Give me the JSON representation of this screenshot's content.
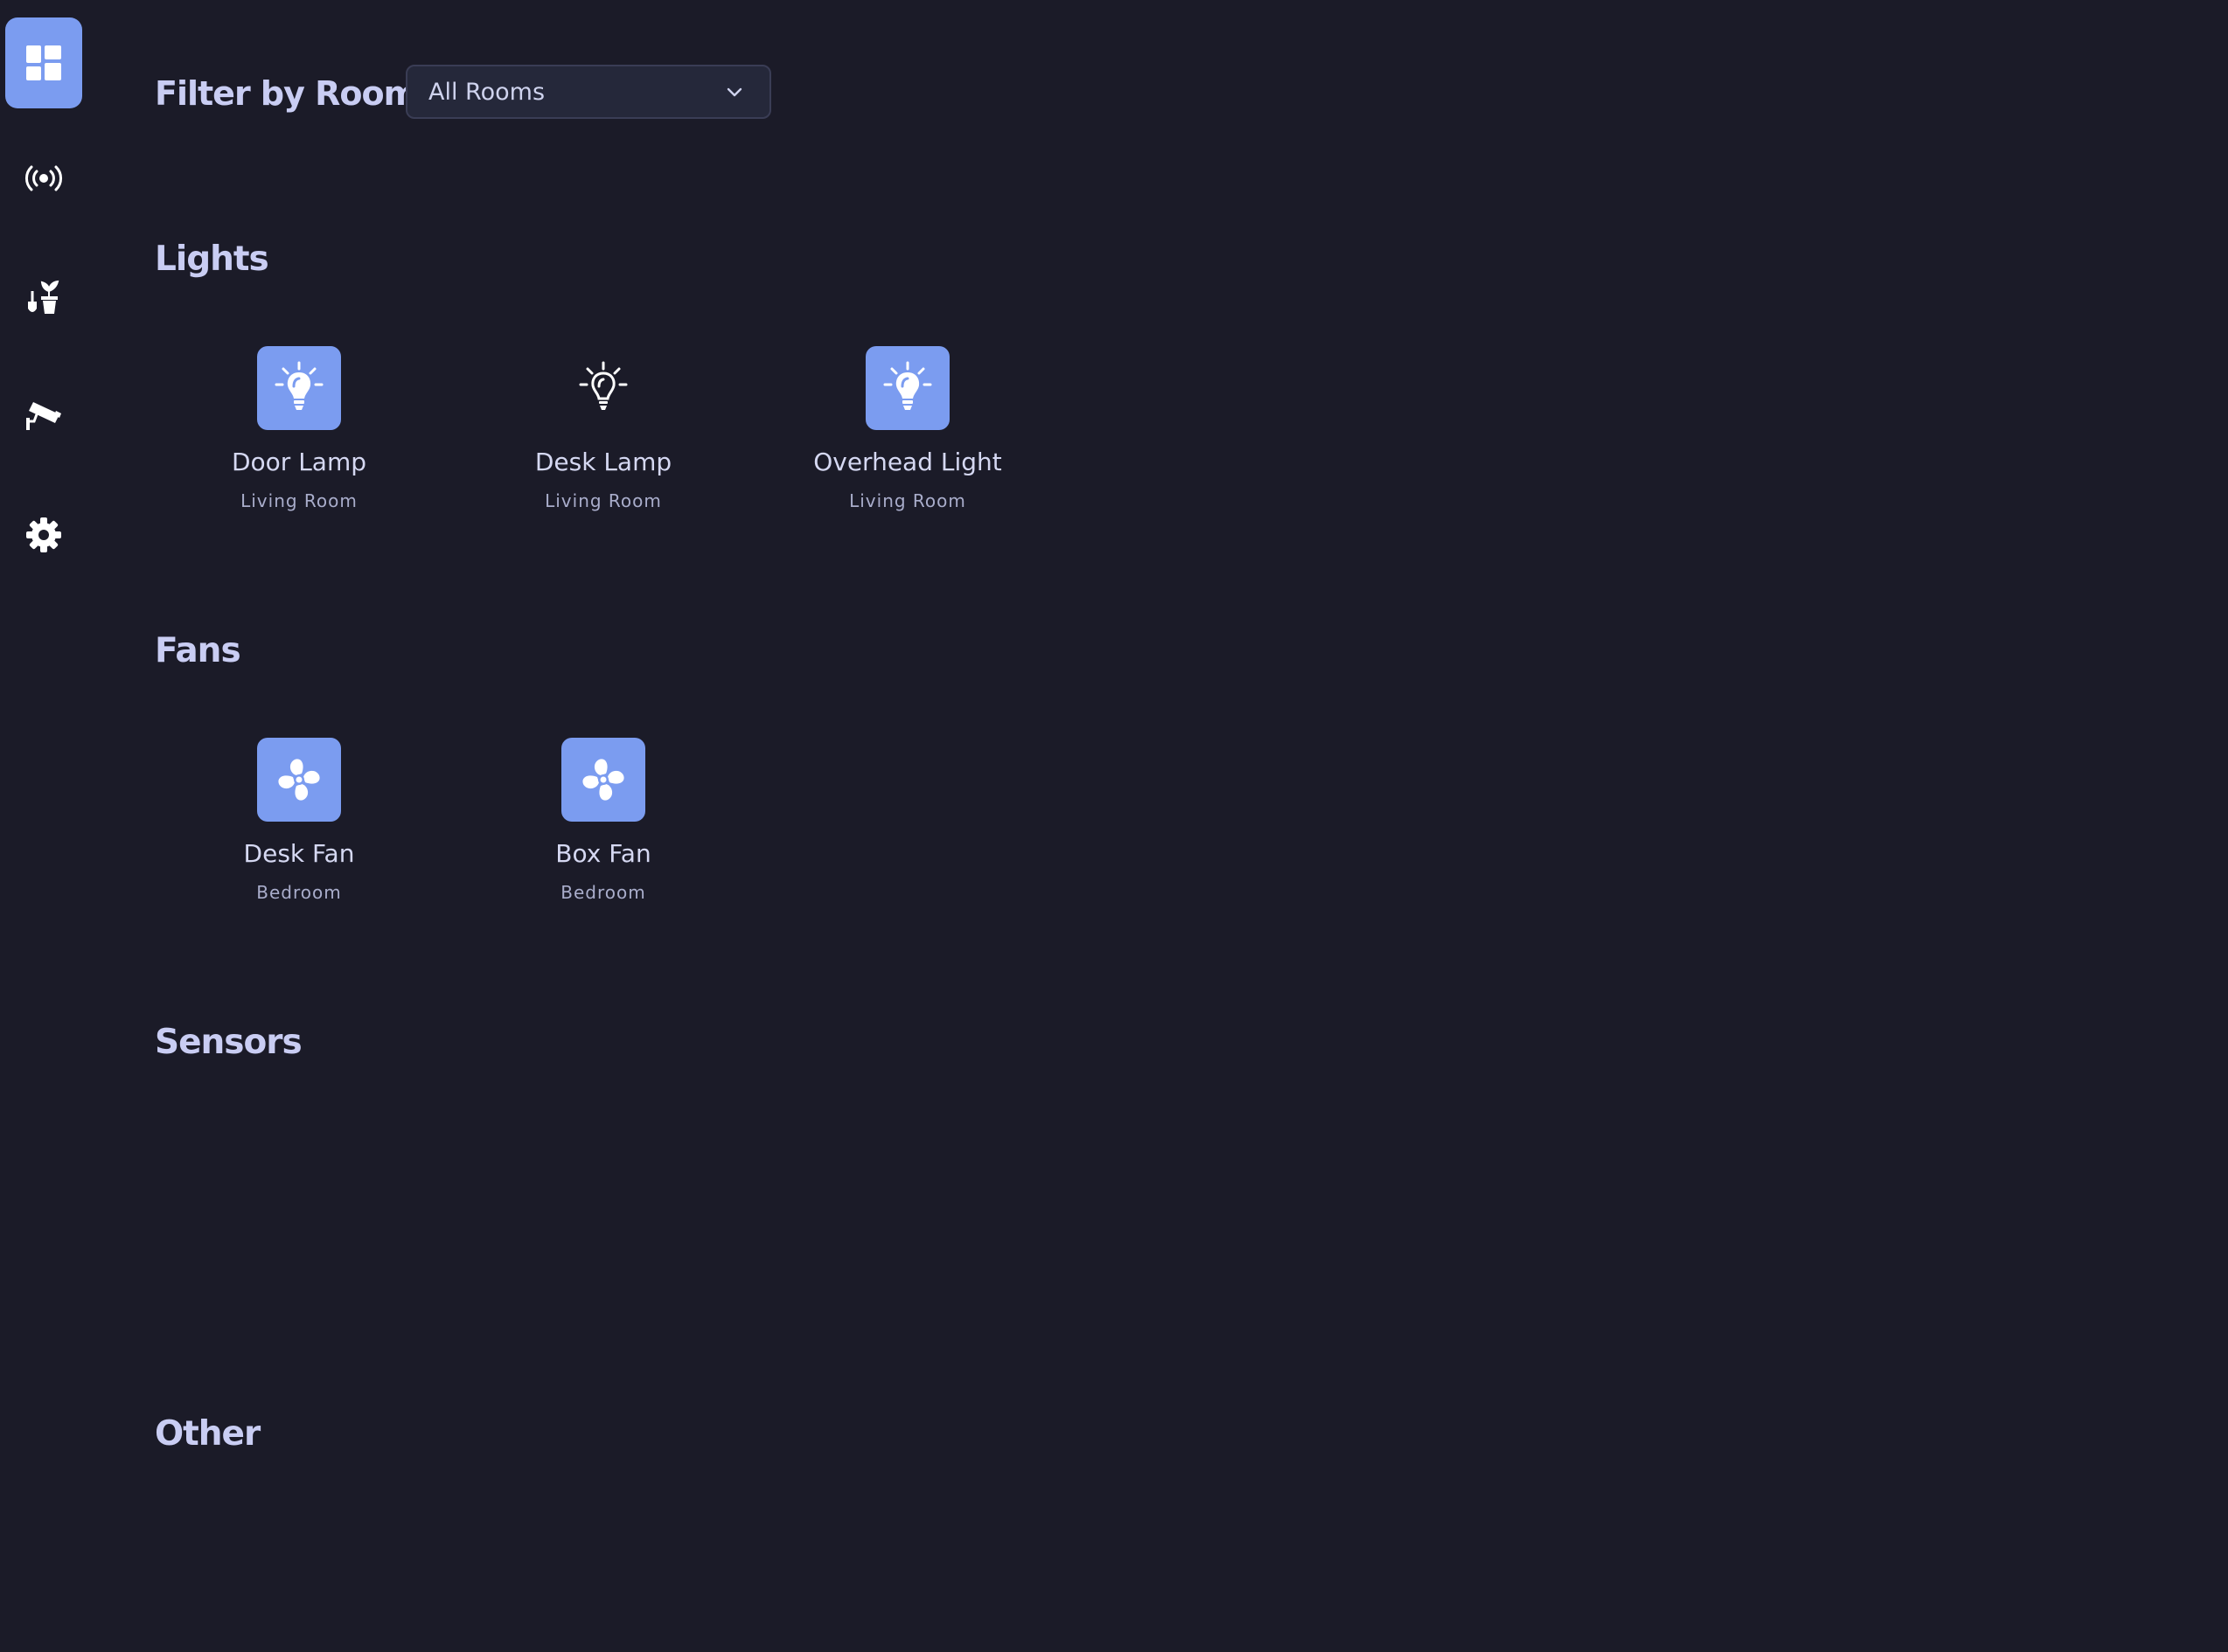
{
  "sidebar": {
    "items": [
      {
        "icon": "dashboard-icon",
        "active": true
      },
      {
        "icon": "broadcast-icon",
        "active": false
      },
      {
        "icon": "plant-tools-icon",
        "active": false
      },
      {
        "icon": "security-camera-icon",
        "active": false
      },
      {
        "icon": "gear-icon",
        "active": false
      }
    ]
  },
  "filter": {
    "label": "Filter by Room:",
    "selected": "All Rooms"
  },
  "sections": {
    "lights": {
      "title": "Lights",
      "devices": [
        {
          "name": "Door Lamp",
          "room": "Living Room",
          "on": true,
          "icon": "lightbulb-icon"
        },
        {
          "name": "Desk Lamp",
          "room": "Living Room",
          "on": false,
          "icon": "lightbulb-icon"
        },
        {
          "name": "Overhead Light",
          "room": "Living Room",
          "on": true,
          "icon": "lightbulb-icon"
        }
      ]
    },
    "fans": {
      "title": "Fans",
      "devices": [
        {
          "name": "Desk Fan",
          "room": "Bedroom",
          "on": true,
          "icon": "fan-icon"
        },
        {
          "name": "Box Fan",
          "room": "Bedroom",
          "on": true,
          "icon": "fan-icon"
        }
      ]
    },
    "sensors": {
      "title": "Sensors",
      "devices": []
    },
    "other": {
      "title": "Other",
      "devices": []
    }
  },
  "colors": {
    "background": "#1b1b28",
    "accent": "#7b9cf0",
    "heading": "#c9cdf3",
    "subtext": "#a9adcb"
  }
}
